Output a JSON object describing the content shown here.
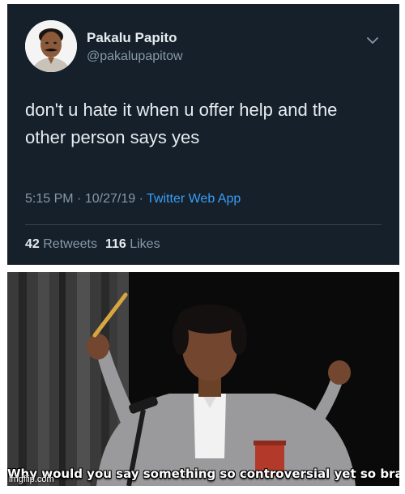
{
  "tweet": {
    "display_name": "Pakalu Papito",
    "handle": "@pakalupapitow",
    "text": "don't u hate it when u offer help and the other person says yes",
    "time": "5:15 PM",
    "date": "10/27/19",
    "separator": "·",
    "source": "Twitter Web App",
    "retweets_count": "42",
    "retweets_label": "Retweets",
    "likes_count": "116",
    "likes_label": "Likes",
    "menu_icon": "chevron-down-icon",
    "colors": {
      "background": "#15202b",
      "text": "#e6ecf0",
      "muted": "#8899a6",
      "link": "#3a9ef5"
    }
  },
  "meme": {
    "caption": "Why would you say something so controversial yet so brave?",
    "watermark": "imgflip.com"
  }
}
